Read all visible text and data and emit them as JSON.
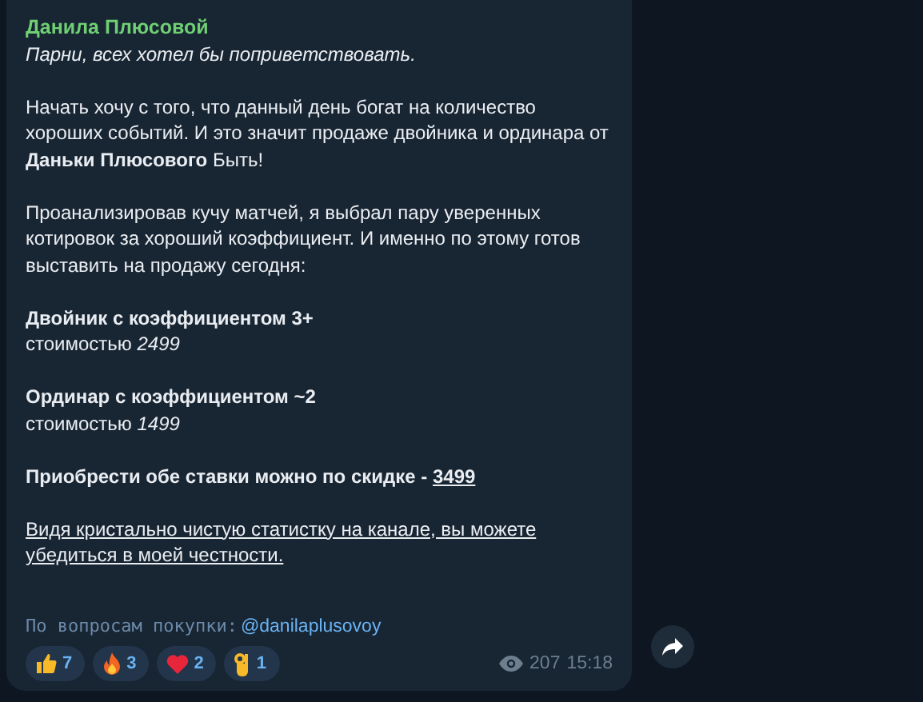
{
  "message": {
    "author": "Данила Плюсовой",
    "paragraphs": [
      {
        "lines": [
          {
            "kind": "italic",
            "text": "Парни, всех хотел бы поприветствовать."
          }
        ]
      },
      {
        "lines": [
          {
            "kind": "plain",
            "text": "Начать хочу с того, что данный день богат на количество хороших событий. И это значит продаже двойника и ординара от **Даньки Плюсового** Быть!"
          }
        ]
      },
      {
        "lines": [
          {
            "kind": "plain",
            "text": "Проанализировав кучу матчей, я выбрал пару уверенных котировок за хороший коэффициент. И именно по этому готов выставить на продажу сегодня:"
          }
        ]
      },
      {
        "lines": [
          {
            "kind": "bold",
            "text": "Двойник с коэффициентом 3+"
          },
          {
            "kind": "plain",
            "text": "стоимостью *2499*"
          }
        ]
      },
      {
        "lines": [
          {
            "kind": "bold",
            "text": "Ординар с коэффициентом ~2"
          },
          {
            "kind": "plain",
            "text": "стоимостью *1499*"
          }
        ]
      },
      {
        "lines": [
          {
            "kind": "bold",
            "text": "Приобрести обе ставки можно по скидке - ",
            "link": "3499"
          }
        ]
      },
      {
        "lines": [
          {
            "kind": "underlined",
            "text": "Видя кристально чистую статистку на канале, вы можете убедиться в моей честности."
          }
        ]
      }
    ],
    "contact": {
      "label": "По вопросам покупки:",
      "handle": "@danilaplusovoy"
    },
    "reactions": [
      {
        "kind": "thumbs-up",
        "count": "7"
      },
      {
        "kind": "fire",
        "count": "3"
      },
      {
        "kind": "heart",
        "count": "2"
      },
      {
        "kind": "ok-hand",
        "count": "1"
      }
    ],
    "views": "207",
    "time": "15:18"
  }
}
